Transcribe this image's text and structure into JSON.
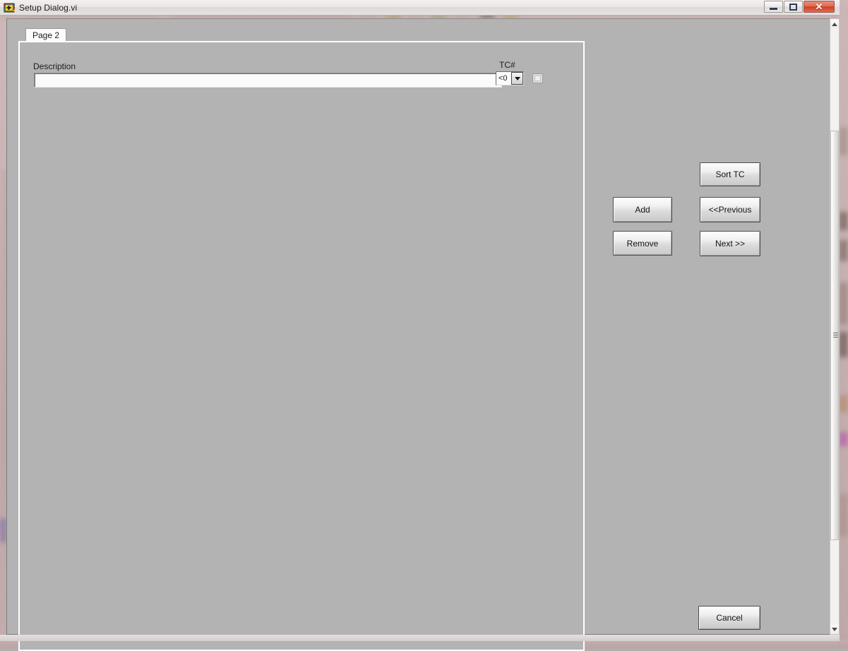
{
  "window": {
    "title": "Setup Dialog.vi",
    "icon": "labview-vi-icon",
    "controls": {
      "minimize": "minimize-icon",
      "maximize": "maximize-icon",
      "close": "✕"
    }
  },
  "tabs": [
    {
      "label": "Page 2",
      "selected": true
    }
  ],
  "form": {
    "description_label": "Description",
    "description_value": "",
    "description_placeholder": "",
    "tc_label": "TC#",
    "tc_value": "<0",
    "tc_checkbox_checked": false
  },
  "buttons": {
    "sort_tc": "Sort TC",
    "add": "Add",
    "previous": "<<Previous",
    "remove": "Remove",
    "next": "Next >>",
    "cancel": "Cancel"
  },
  "scrollbar": {
    "up_arrow": "scroll-up-icon",
    "down_arrow": "scroll-down-icon",
    "grip": "scroll-grip-icon"
  },
  "colors": {
    "panel_bg": "#b3b3b3",
    "panel_border": "#ffffff",
    "titlebar_bg": "#ece8e7",
    "close_button": "#cf3f22",
    "input_bg": "#fbfbfb",
    "tab_bg": "#fcfcfc"
  }
}
